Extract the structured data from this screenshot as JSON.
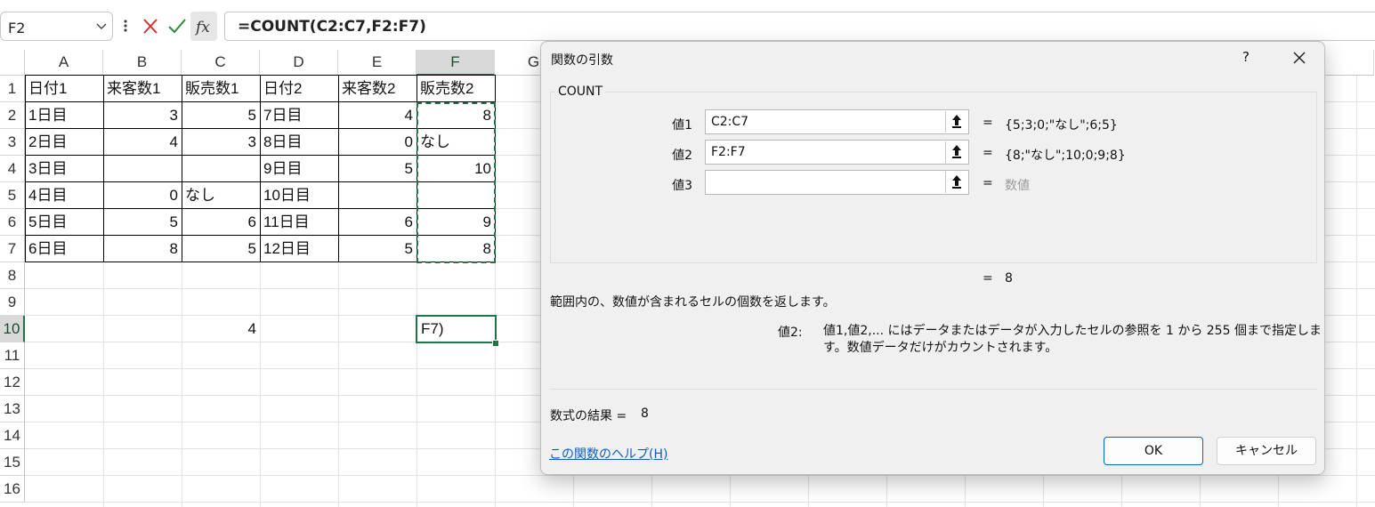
{
  "formula_bar": {
    "name_box": "F2",
    "formula": "=COUNT(C2:C7,F2:F7)"
  },
  "sheet": {
    "columns": [
      "A",
      "B",
      "C",
      "D",
      "E",
      "F",
      "G"
    ],
    "rows": [
      "1",
      "2",
      "3",
      "4",
      "5",
      "6",
      "7",
      "8",
      "9",
      "10",
      "11",
      "12",
      "13",
      "14",
      "15",
      "16"
    ],
    "cells": {
      "A1": "日付1",
      "B1": "来客数1",
      "C1": "販売数1",
      "D1": "日付2",
      "E1": "来客数2",
      "F1": "販売数2",
      "A2": "1日目",
      "B2": "3",
      "C2": "5",
      "D2": "7日目",
      "E2": "4",
      "F2": "8",
      "A3": "2日目",
      "B3": "4",
      "C3": "3",
      "D3": "8日目",
      "E3": "0",
      "F3": "なし",
      "A4": "3日目",
      "B4": "",
      "C4": "",
      "D4": "9日目",
      "E4": "5",
      "F4": "10",
      "A5": "4日目",
      "B5": "0",
      "C5": "なし",
      "D5": "10日目",
      "E5": "",
      "F5": "",
      "A6": "5日目",
      "B6": "5",
      "C6": "6",
      "D6": "11日目",
      "E6": "6",
      "F6": "9",
      "A7": "6日目",
      "B7": "8",
      "C7": "5",
      "D7": "12日目",
      "E7": "5",
      "F7": "8",
      "C10": "4",
      "F10": "F7)"
    }
  },
  "dialog": {
    "title": "関数の引数",
    "help": "?",
    "function_name": "COUNT",
    "args": [
      {
        "label": "値1",
        "value": "C2:C7",
        "result": "{5;3;0;\"なし\";6;5}"
      },
      {
        "label": "値2",
        "value": "F2:F7",
        "result": "{8;\"なし\";10;0;9;8}"
      },
      {
        "label": "値3",
        "value": "",
        "result": "数値"
      }
    ],
    "eq": "=",
    "result_value": "8",
    "description": "範囲内の、数値が含まれるセルの個数を返します。",
    "arg_desc_name": "値2:",
    "arg_desc_text": "値1,値2,... にはデータまたはデータが入力したセルの参照を 1 から 255 個まで指定します。数値データだけがカウントされます。",
    "formula_result_label": "数式の結果 =",
    "formula_result_value": "8",
    "help_link": "この関数のヘルプ(H)",
    "ok": "OK",
    "cancel": "キャンセル"
  }
}
